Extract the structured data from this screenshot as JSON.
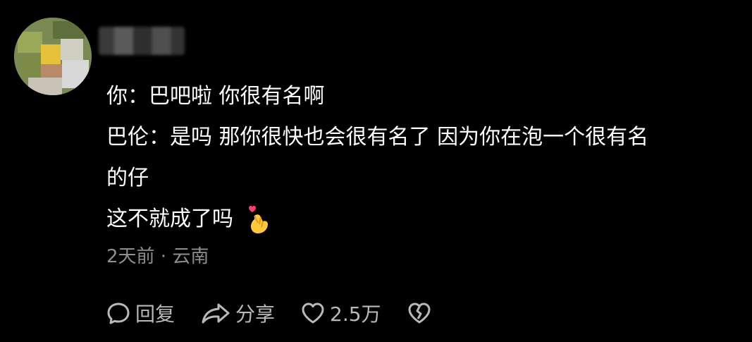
{
  "comment": {
    "lines": [
      "你：巴吧啦 你很有名啊",
      "巴伦：是吗 那你很快也会很有名了 因为你在泡一个很有名",
      "的仔",
      "这不就成了吗"
    ],
    "emoji": "finger-heart-emoji",
    "meta": "2天前 · 云南"
  },
  "actions": {
    "reply_label": "回复",
    "share_label": "分享",
    "like_count": "2.5万"
  },
  "colors": {
    "background": "#000000",
    "text": "#ffffff",
    "meta": "#8e8e8e",
    "icon": "#b9b9b9"
  }
}
